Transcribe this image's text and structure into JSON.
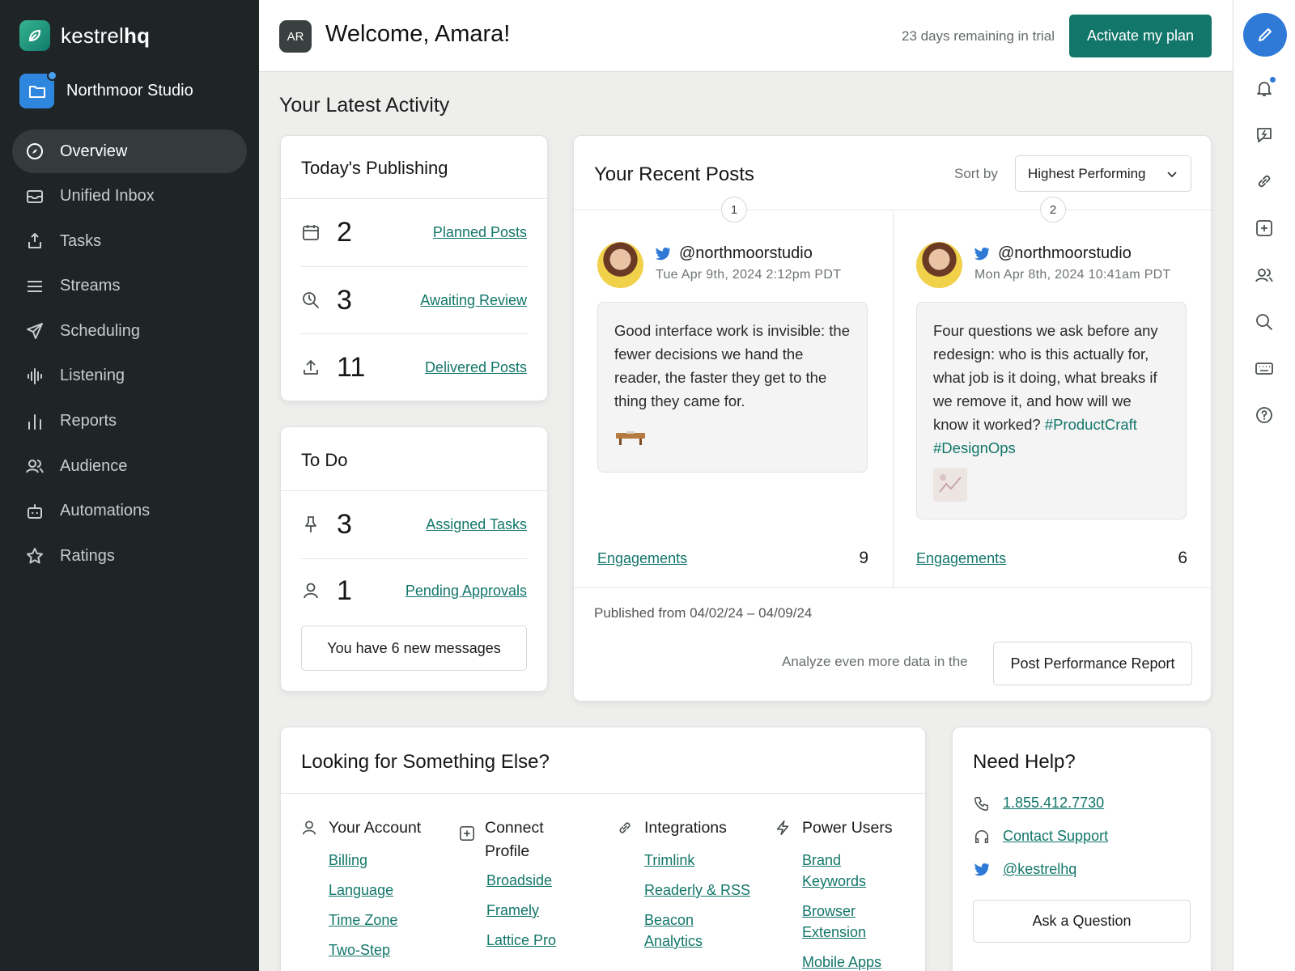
{
  "app": {
    "brand_light": "kestrel",
    "brand_bold": "hq",
    "org_name": "Northmoor Studio"
  },
  "colors": {
    "accent": "#12766a",
    "sidebar": "#1f2526",
    "compose": "#2f7ad6"
  },
  "sidebar": {
    "items": [
      {
        "label": "Overview",
        "icon": "compass-icon",
        "active": true
      },
      {
        "label": "Unified Inbox",
        "icon": "inbox-icon"
      },
      {
        "label": "Tasks",
        "icon": "task-icon"
      },
      {
        "label": "Streams",
        "icon": "menu-lines-icon"
      },
      {
        "label": "Scheduling",
        "icon": "paper-plane-icon"
      },
      {
        "label": "Listening",
        "icon": "sound-wave-icon"
      },
      {
        "label": "Reports",
        "icon": "bar-chart-icon"
      },
      {
        "label": "Audience",
        "icon": "users-icon"
      },
      {
        "label": "Automations",
        "icon": "robot-icon"
      },
      {
        "label": "Ratings",
        "icon": "star-icon"
      }
    ]
  },
  "header": {
    "avatar_initials": "AR",
    "welcome": "Welcome, Amara!",
    "trial_text": "23 days remaining in trial",
    "activate_label": "Activate my plan"
  },
  "rail": [
    "compose-icon",
    "bell-icon",
    "chat-bolt-icon",
    "link-icon",
    "add-square-icon",
    "users-icon",
    "search-icon",
    "keyboard-icon",
    "help-icon"
  ],
  "main": {
    "section_title": "Your Latest Activity",
    "publishing": {
      "title": "Today's Publishing",
      "rows": [
        {
          "icon": "calendar-icon",
          "value": "2",
          "label": "Planned Posts"
        },
        {
          "icon": "search-clock-icon",
          "value": "3",
          "label": "Awaiting Review"
        },
        {
          "icon": "upload-icon",
          "value": "11",
          "label": "Delivered Posts"
        }
      ]
    },
    "todo": {
      "title": "To Do",
      "rows": [
        {
          "icon": "pin-icon",
          "value": "3",
          "label": "Assigned Tasks"
        },
        {
          "icon": "user-icon",
          "value": "1",
          "label": "Pending Approvals"
        }
      ],
      "messages_button": "You have 6 new messages"
    },
    "recent_posts": {
      "title": "Your Recent Posts",
      "sort_label": "Sort by",
      "sort_value": "Highest Performing",
      "posts": [
        {
          "rank": "1",
          "handle": "@northmoorstudio",
          "time": "Tue Apr 9th, 2024 2:12pm PDT",
          "body": "Good interface work is invisible: the fewer decisions we hand the reader, the faster they get to the thing they came for.",
          "hashtags": "",
          "eng_label": "Engagements",
          "eng_value": "9"
        },
        {
          "rank": "2",
          "handle": "@northmoorstudio",
          "time": "Mon Apr 8th, 2024 10:41am PDT",
          "body": "Four questions we ask before any redesign: who is this actually for, what job is it doing, what breaks if we remove it, and how will we know it worked?",
          "hashtags": "#ProductCraft #DesignOps",
          "eng_label": "Engagements",
          "eng_value": "6"
        }
      ],
      "published_range": "Published from 04/02/24 – 04/09/24",
      "analyze_text": "Analyze even more data in the",
      "report_button": "Post Performance Report"
    },
    "looking": {
      "title": "Looking for Something Else?",
      "columns": [
        {
          "icon": "user-icon",
          "title": "Your Account",
          "links": [
            "Billing",
            "Language",
            "Time Zone",
            "Two-Step"
          ]
        },
        {
          "icon": "add-square-icon",
          "title": "Connect Profile",
          "links": [
            "Broadside",
            "Framely",
            "Lattice Pro"
          ]
        },
        {
          "icon": "link-icon",
          "title": "Integrations",
          "links": [
            "Trimlink",
            "Readerly & RSS",
            "Beacon Analytics"
          ]
        },
        {
          "icon": "bolt-icon",
          "title": "Power Users",
          "links": [
            "Brand Keywords",
            "Browser Extension",
            "Mobile Apps"
          ]
        }
      ]
    },
    "help": {
      "title": "Need Help?",
      "phone": "1.855.412.7730",
      "contact": "Contact Support",
      "twitter": "@kestrelhq",
      "ask_button": "Ask a Question"
    }
  }
}
